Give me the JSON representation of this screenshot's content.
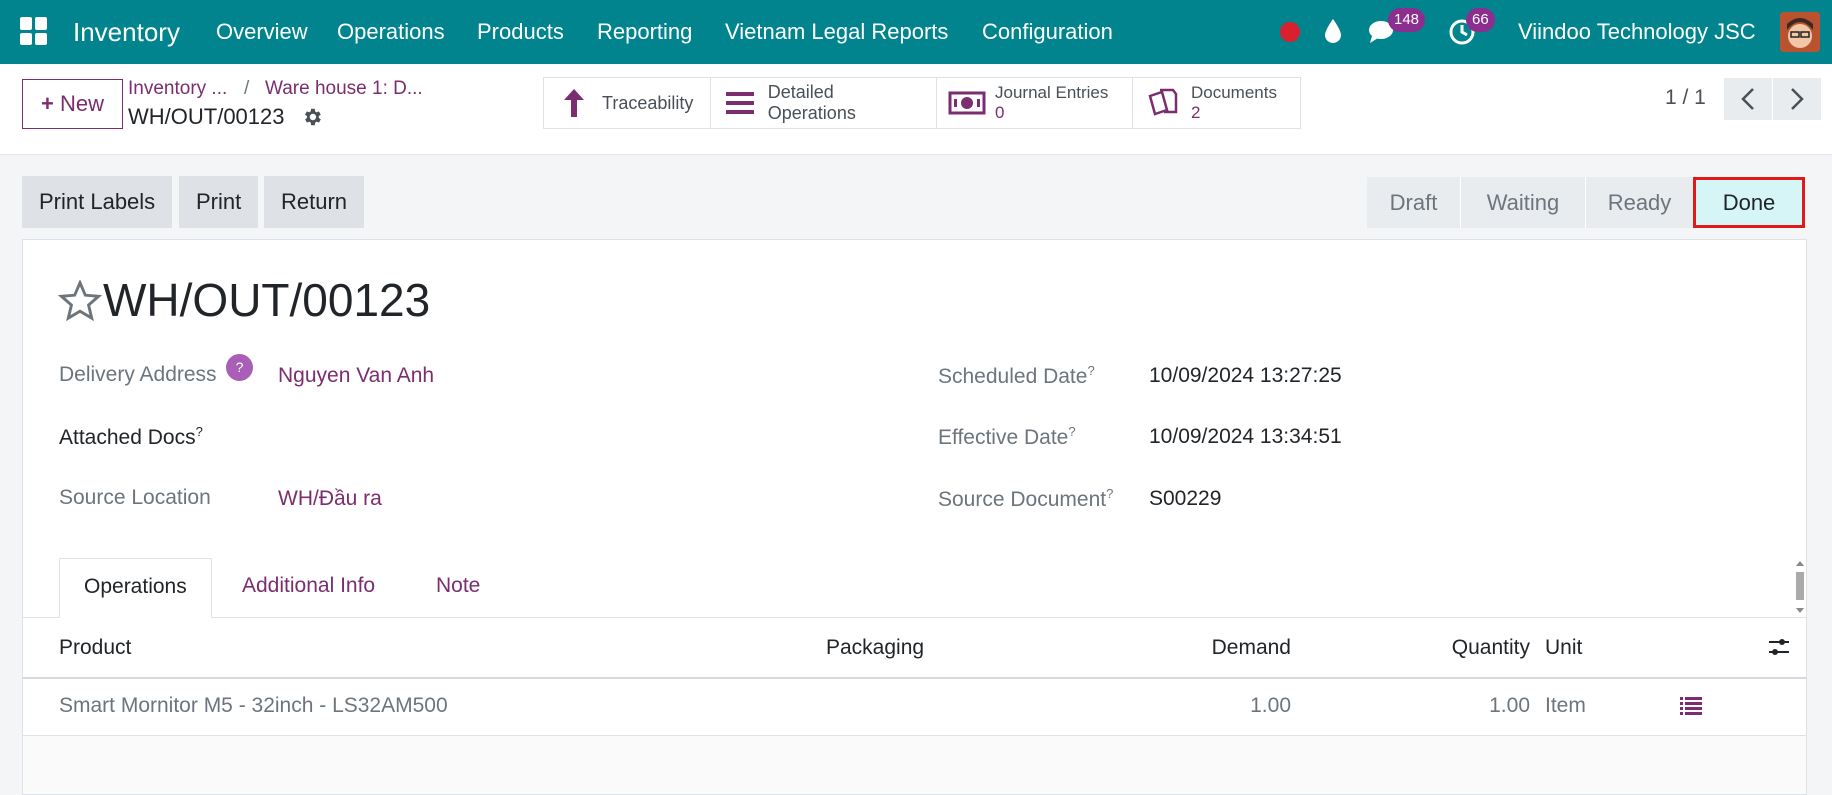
{
  "navbar": {
    "app_name": "Inventory",
    "menu": [
      "Overview",
      "Operations",
      "Products",
      "Reporting",
      "Vietnam Legal Reports",
      "Configuration"
    ],
    "messages_count": "148",
    "activities_count": "66",
    "company": "Viindoo Technology JSC",
    "accent_color": "#01848e"
  },
  "control_panel": {
    "new_label": "New",
    "breadcrumb_root": "Inventory ...",
    "breadcrumb_separator": "/",
    "breadcrumb_parent": "Ware house 1: D...",
    "record_ref": "WH/OUT/00123",
    "smart_buttons": {
      "traceability": "Traceability",
      "detailed_operations": "Detailed Operations",
      "journal_entries": "Journal Entries",
      "journal_entries_count": "0",
      "documents": "Documents",
      "documents_count": "2"
    },
    "pager": "1 / 1"
  },
  "actions": {
    "print_labels": "Print Labels",
    "print": "Print",
    "return": "Return"
  },
  "statusbar": {
    "steps": [
      "Draft",
      "Waiting",
      "Ready",
      "Done"
    ],
    "current": "Done"
  },
  "form": {
    "title": "WH/OUT/00123",
    "delivery_address_label": "Delivery Address",
    "delivery_address": "Nguyen Van Anh",
    "help_mark": "?",
    "attached_docs_label": "Attached Docs",
    "source_location_label": "Source Location",
    "source_location": "WH/Đầu ra",
    "scheduled_date_label": "Scheduled Date",
    "scheduled_date": "10/09/2024 13:27:25",
    "effective_date_label": "Effective Date",
    "effective_date": "10/09/2024 13:34:51",
    "source_document_label": "Source Document",
    "source_document": "S00229",
    "superscript": "?"
  },
  "tabs": [
    "Operations",
    "Additional Info",
    "Note"
  ],
  "table": {
    "headers": {
      "product": "Product",
      "packaging": "Packaging",
      "demand": "Demand",
      "quantity": "Quantity",
      "unit": "Unit"
    },
    "rows": [
      {
        "product": "Smart Mornitor M5 - 32inch - LS32AM500",
        "packaging": "",
        "demand": "1.00",
        "quantity": "1.00",
        "unit": "Item"
      }
    ]
  }
}
